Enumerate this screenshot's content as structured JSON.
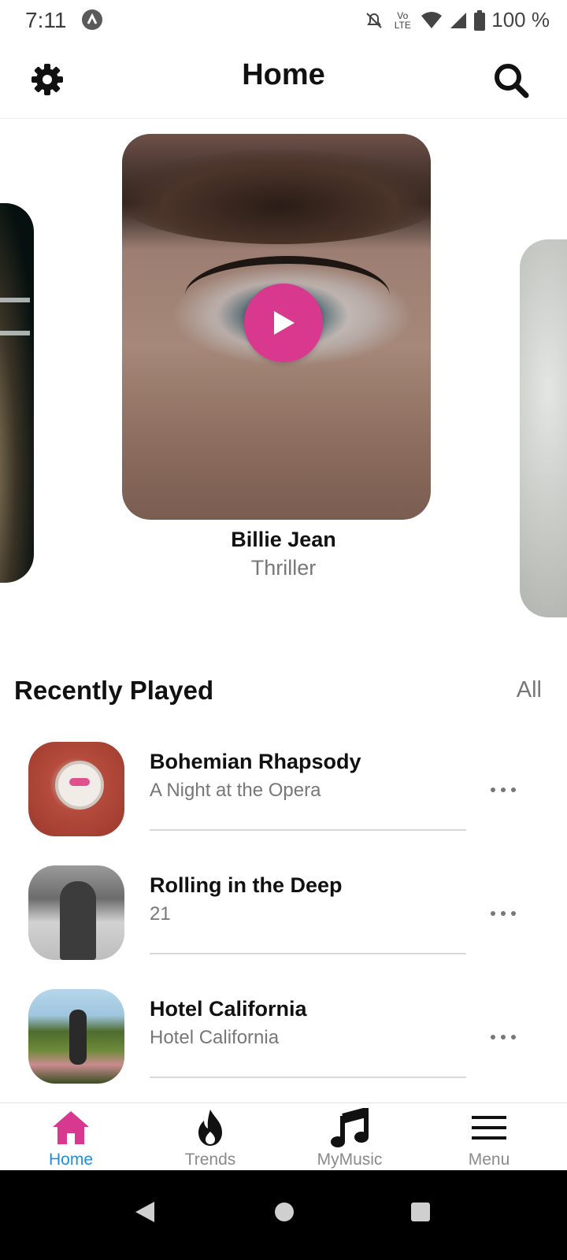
{
  "status_bar": {
    "time": "7:11",
    "volte_label": "Vo LTE",
    "battery": "100 %"
  },
  "header": {
    "title": "Home",
    "settings_icon": "gear-icon",
    "search_icon": "search-icon"
  },
  "featured": {
    "title": "Billie Jean",
    "subtitle": "Thriller",
    "play_icon": "play-icon",
    "accent_color": "#d8398e"
  },
  "recently_played": {
    "title": "Recently Played",
    "all_label": "All",
    "items": [
      {
        "title": "Bohemian Rhapsody",
        "album": "A Night at the Opera"
      },
      {
        "title": "Rolling in the Deep",
        "album": "21"
      },
      {
        "title": "Hotel California",
        "album": "Hotel California"
      }
    ]
  },
  "bottom_nav": {
    "items": [
      {
        "label": "Home",
        "icon": "home-icon",
        "active": true
      },
      {
        "label": "Trends",
        "icon": "flame-icon",
        "active": false
      },
      {
        "label": "MyMusic",
        "icon": "music-note-icon",
        "active": false
      },
      {
        "label": "Menu",
        "icon": "menu-icon",
        "active": false
      }
    ],
    "active_color": "#1e8fe0",
    "active_icon_color": "#d8398e"
  }
}
